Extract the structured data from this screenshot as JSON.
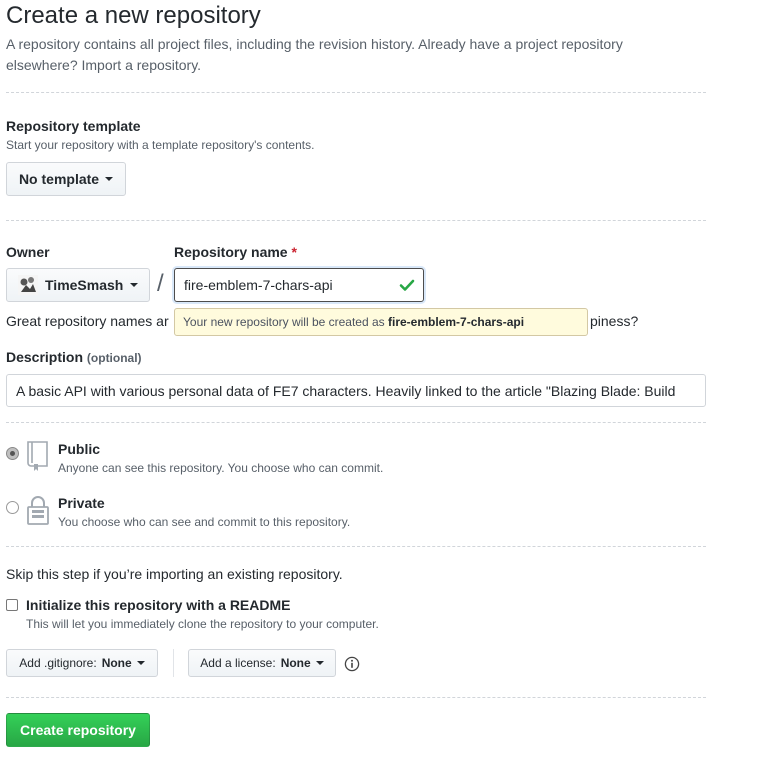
{
  "page": {
    "title": "Create a new repository",
    "intro_line1": "A repository contains all project files, including the revision history. Already have a project repository",
    "intro_line2_prefix": "elsewhere? ",
    "import_link": "Import a repository."
  },
  "template": {
    "label": "Repository template",
    "note": "Start your repository with a template repository's contents.",
    "button": "No template"
  },
  "owner": {
    "label": "Owner",
    "value": "TimeSmash",
    "separator": "/"
  },
  "repo_name": {
    "label": "Repository name",
    "required_mark": "*",
    "value": "fire-emblem-7-chars-api",
    "tooltip_prefix": "Your new repository will be created as ",
    "tooltip_name": "fire-emblem-7-chars-api"
  },
  "hint": {
    "start": "Great repository names ar",
    "end": "piness?"
  },
  "description": {
    "label": "Description",
    "optional": "(optional)",
    "value": "A basic API with various personal data of FE7 characters. Heavily linked to the article \"Blazing Blade: Build"
  },
  "visibility": {
    "public": {
      "label": "Public",
      "note": "Anyone can see this repository. You choose who can commit.",
      "selected": true
    },
    "private": {
      "label": "Private",
      "note": "You choose who can see and commit to this repository.",
      "selected": false
    }
  },
  "init": {
    "skip_note": "Skip this step if you’re importing an existing repository.",
    "readme_label": "Initialize this repository with a README",
    "readme_note": "This will let you immediately clone the repository to your computer.",
    "readme_checked": false
  },
  "gitignore": {
    "prefix": "Add .gitignore: ",
    "value": "None"
  },
  "license": {
    "prefix": "Add a license: ",
    "value": "None"
  },
  "submit": {
    "label": "Create repository"
  },
  "colors": {
    "accent_green": "#28a745",
    "check_green": "#28a745",
    "tooltip_bg": "#fffbdd"
  },
  "icons": [
    "caret-down-icon",
    "owner-avatar-icon",
    "check-icon",
    "repo-book-icon",
    "lock-icon",
    "info-icon"
  ]
}
